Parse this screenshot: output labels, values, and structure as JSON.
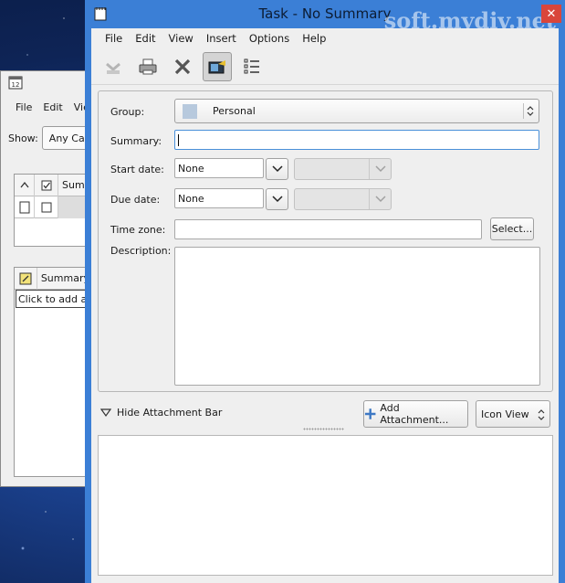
{
  "colors": {
    "titlebar": "#3b7fd6",
    "close_button": "#d9463b",
    "group_swatch": "#b7c9dd",
    "focus_border": "#4a90d9"
  },
  "watermark": "soft.mydiv.net",
  "background_window": {
    "menu": [
      "File",
      "Edit",
      "Vie"
    ],
    "show_label": "Show:",
    "show_value": "Any Cat",
    "list_header": "Sum",
    "list2_header": "Summary",
    "list2_placeholder": "Click to add a m"
  },
  "dialog": {
    "title": "Task - No Summary",
    "menu": [
      "File",
      "Edit",
      "View",
      "Insert",
      "Options",
      "Help"
    ],
    "toolbar": [
      "save-close",
      "print",
      "delete",
      "attachments",
      "description"
    ],
    "group_label": "Group:",
    "group_value": "Personal",
    "summary_label": "Summary:",
    "summary_value": "",
    "start_label": "Start date:",
    "start_value": "None",
    "due_label": "Due date:",
    "due_value": "None",
    "timezone_label": "Time zone:",
    "timezone_value": "",
    "select_button": "Select...",
    "description_label": "Description:",
    "description_value": "",
    "hide_attachment": "Hide Attachment Bar",
    "add_attachment": "Add Attachment...",
    "view_mode": "Icon View"
  }
}
